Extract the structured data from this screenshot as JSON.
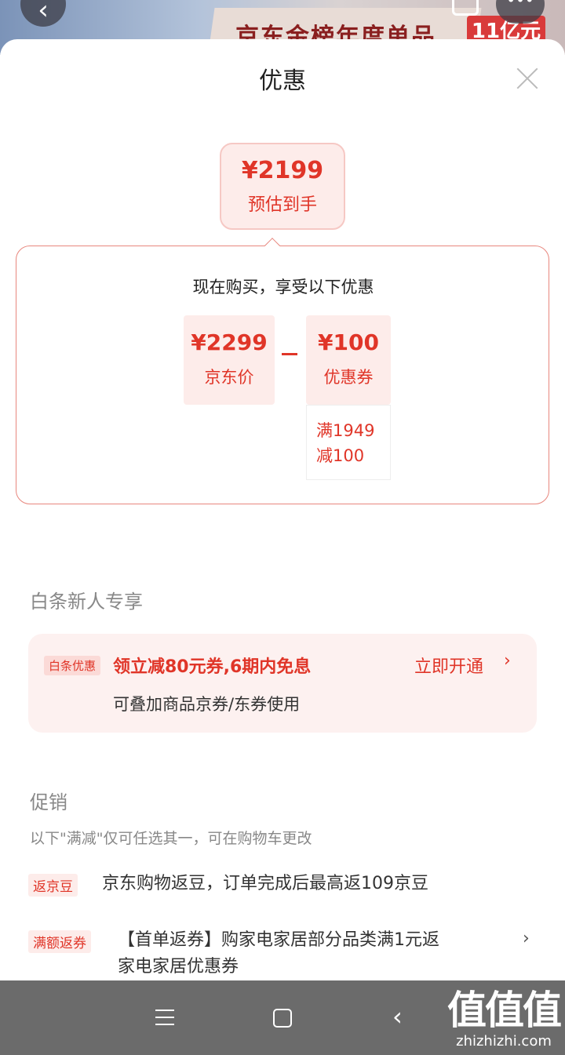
{
  "background": {
    "banner_text": "京东金榜年度单品",
    "red_badge": "11亿元",
    "back_icon": "chevron-left-icon",
    "more_icon": "more-icon"
  },
  "sheet": {
    "title": "优惠",
    "close_icon": "close-icon"
  },
  "estimate": {
    "price": "¥2199",
    "label": "预估到手"
  },
  "breakdown": {
    "headline": "现在购买，享受以下优惠",
    "price_value": "¥2299",
    "price_label": "京东价",
    "coupon_value": "¥100",
    "coupon_label": "优惠券",
    "coupon_cond_line1": "满1949",
    "coupon_cond_line2": "减100"
  },
  "baitiao": {
    "section_title": "白条新人专享",
    "tag": "白条优惠",
    "main": "领立减80元券,6期内免息",
    "sub": "可叠加商品京券/东券使用",
    "action": "立即开通",
    "chevron": "›"
  },
  "promotions": {
    "section_title": "促销",
    "note": "以下\"满减\"仅可任选其一，可在购物车更改",
    "items": [
      {
        "tag": "返京豆",
        "text": "京东购物返豆，订单完成后最高返109京豆"
      },
      {
        "tag": "满额返券",
        "text_line1": "【首单返券】购家电家居部分品类满1元返",
        "text_line2": "家电家居优惠券",
        "chevron": "›"
      }
    ]
  },
  "navbar": {
    "menu_icon": "menu-icon",
    "home_icon": "home-icon",
    "back_icon": "back-icon",
    "back_glyph": "‹"
  },
  "watermark": {
    "big": "值值值",
    "small": "zhizhizhi.com"
  },
  "colors": {
    "accent": "#e03528",
    "pink_bg": "#fdecea",
    "navbar": "#6b6b6b"
  }
}
